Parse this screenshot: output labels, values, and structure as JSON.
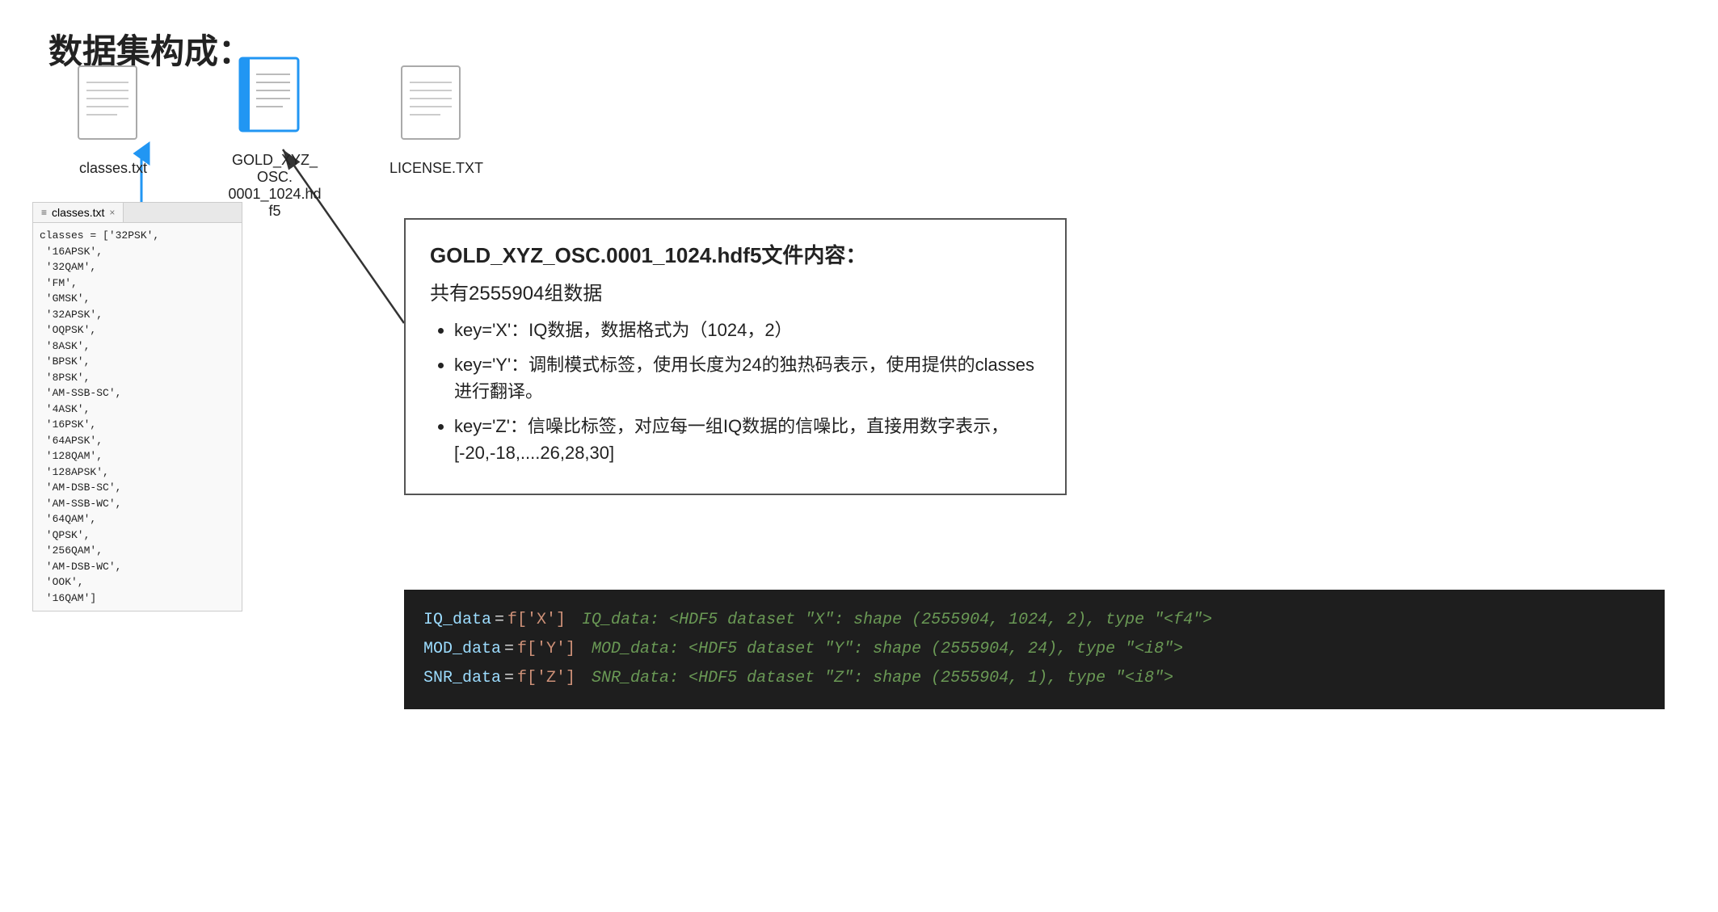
{
  "page": {
    "title": "数据集构成："
  },
  "files": [
    {
      "name": "classes.txt",
      "type": "txt",
      "selected": false
    },
    {
      "name": "GOLD_XYZ_OSC.\n0001_1024.hdf5",
      "type": "hdf5",
      "selected": true
    },
    {
      "name": "LICENSE.TXT",
      "type": "txt",
      "selected": false
    }
  ],
  "editor": {
    "tab_label": "classes.txt",
    "tab_icon": "≡",
    "close": "×",
    "content_lines": [
      "classes = ['32PSK',",
      " '16APSK',",
      " '32QAM',",
      " 'FM',",
      " 'GMSK',",
      " '32APSK',",
      " 'OQPSK',",
      " '8ASK',",
      " 'BPSK',",
      " '8PSK',",
      " 'AM-SSB-SC',",
      " '4ASK',",
      " '16PSK',",
      " '64APSK',",
      " '128QAM',",
      " '128APSK',",
      " 'AM-DSB-SC',",
      " 'AM-SSB-WC',",
      " '64QAM',",
      " 'QPSK',",
      " '256QAM',",
      " 'AM-DSB-WC',",
      " 'OOK',",
      " '16QAM']"
    ]
  },
  "info_box": {
    "title": "GOLD_XYZ_OSC.0001_1024.hdf5文件内容：",
    "subtitle": "共有2555904组数据",
    "bullets": [
      "key='X'：IQ数据，数据格式为（1024，2）",
      "key='Y'：调制模式标签，使用长度为24的独热码表示，使用提供的classes进行翻译。",
      "key='Z'：信噪比标签，对应每一组IQ数据的信噪比，直接用数字表示，[-20,-18,....26,28,30]"
    ]
  },
  "code_block": {
    "lines": [
      {
        "var": "IQ_data",
        "op": "=",
        "key": "f['X']",
        "comment": "IQ_data: <HDF5 dataset \"X\": shape (2555904, 1024, 2), type \"<f4\">"
      },
      {
        "var": "MOD_data",
        "op": "=",
        "key": "f['Y']",
        "comment": "MOD_data: <HDF5 dataset \"Y\": shape (2555904, 24), type \"<i8\">"
      },
      {
        "var": "SNR_data",
        "op": "=",
        "key": "f['Z']",
        "comment": "SNR_data: <HDF5 dataset \"Z\": shape (2555904, 1), type \"<i8\">"
      }
    ]
  }
}
